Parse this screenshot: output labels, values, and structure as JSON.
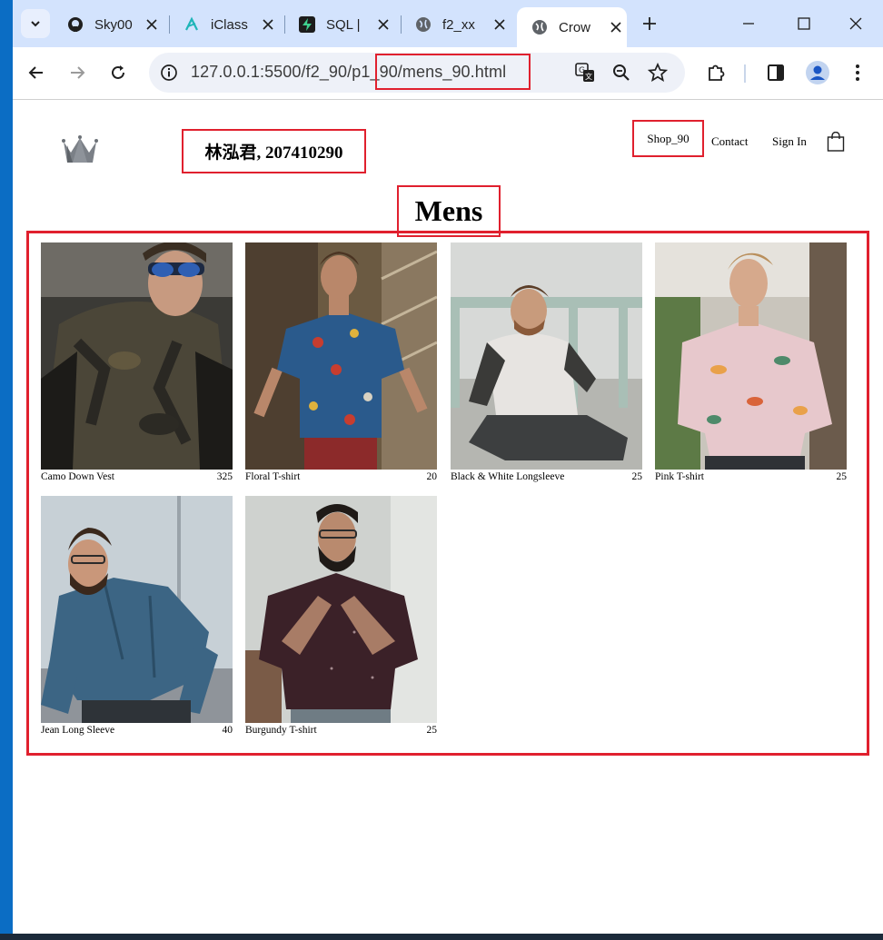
{
  "browser": {
    "tabs": [
      {
        "title": "Sky00",
        "icon": "github-icon"
      },
      {
        "title": "iClass",
        "icon": "iclass-icon"
      },
      {
        "title": "SQL |",
        "icon": "supabase-icon"
      },
      {
        "title": "f2_xx",
        "icon": "globe-icon"
      },
      {
        "title": "Crow",
        "icon": "globe-icon",
        "active": true
      }
    ],
    "url": "127.0.0.1:5500/f2_90/p1_90/mens_90.html"
  },
  "header": {
    "student": "林泓君, 207410290",
    "nav": {
      "shop": "Shop_90",
      "contact": "Contact",
      "signin": "Sign In"
    }
  },
  "page": {
    "title": "Mens"
  },
  "products": [
    {
      "name": "Camo Down Vest",
      "price": "325"
    },
    {
      "name": "Floral T-shirt",
      "price": "20"
    },
    {
      "name": "Black & White Longsleeve",
      "price": "25"
    },
    {
      "name": "Pink T-shirt",
      "price": "25"
    },
    {
      "name": "Jean Long Sleeve",
      "price": "40"
    },
    {
      "name": "Burgundy T-shirt",
      "price": "25"
    }
  ],
  "colors": {
    "highlight": "#e0202e",
    "tabstrip": "#d3e3fd"
  }
}
